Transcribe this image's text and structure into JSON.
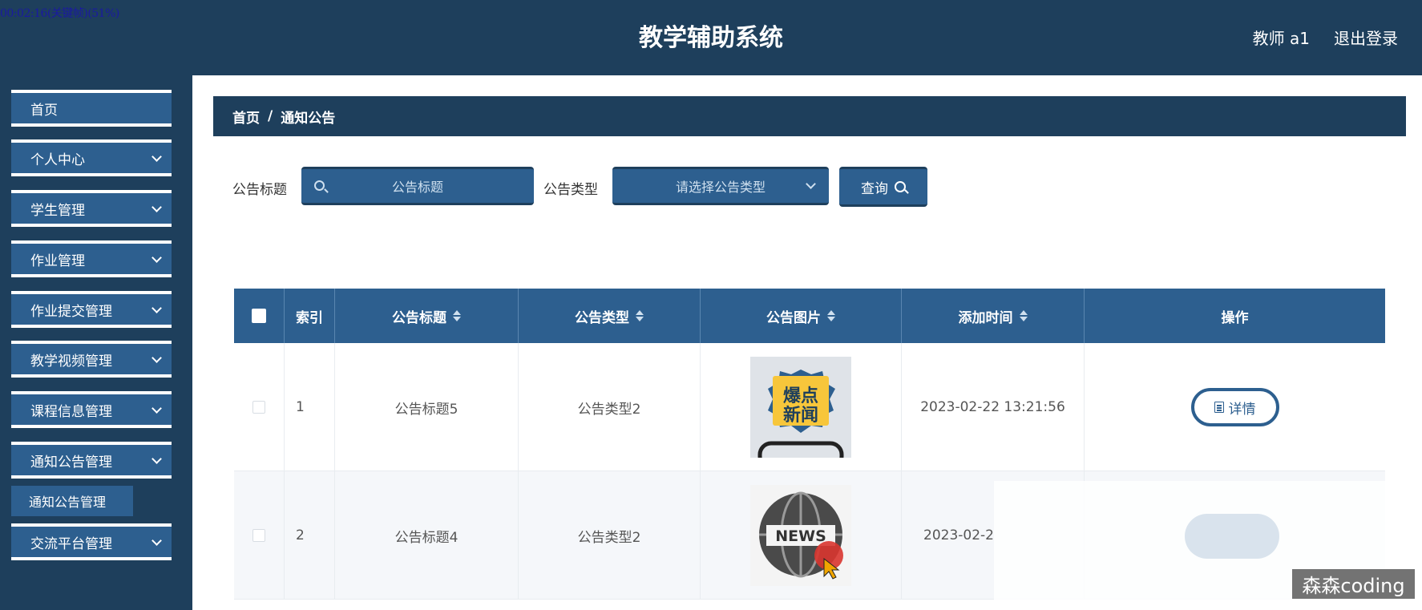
{
  "overlay": {
    "text": "00:02:16(关键帧)(51%)"
  },
  "header": {
    "title": "教学辅助系统",
    "user": "教师 a1",
    "logout": "退出登录"
  },
  "sidebar": {
    "items": [
      {
        "label": "首页"
      },
      {
        "label": "个人中心"
      },
      {
        "label": "学生管理"
      },
      {
        "label": "作业管理"
      },
      {
        "label": "作业提交管理"
      },
      {
        "label": "教学视频管理"
      },
      {
        "label": "课程信息管理"
      },
      {
        "label": "通知公告管理"
      },
      {
        "label": "交流平台管理"
      }
    ],
    "submenu": {
      "label": "通知公告管理"
    }
  },
  "breadcrumb": {
    "home": "首页",
    "sep": "/",
    "current": "通知公告"
  },
  "filters": {
    "title_label": "公告标题",
    "title_placeholder": "公告标题",
    "type_label": "公告类型",
    "type_placeholder": "请选择公告类型",
    "query_button": "查询"
  },
  "table": {
    "columns": [
      "",
      "索引",
      "公告标题",
      "公告类型",
      "公告图片",
      "添加时间",
      "操作"
    ],
    "rows": [
      {
        "index": "1",
        "title": "公告标题5",
        "type": "公告类型2",
        "image": "爆点新闻",
        "time": "2023-02-22 13:21:56",
        "action": "详情"
      },
      {
        "index": "2",
        "title": "公告标题4",
        "type": "公告类型2",
        "image": "NEWS",
        "time": "2023-02-2",
        "action": ""
      }
    ]
  },
  "watermark": "森森coding",
  "colors": {
    "dark": "#1e3f5c",
    "accent": "#2d5f8f"
  }
}
